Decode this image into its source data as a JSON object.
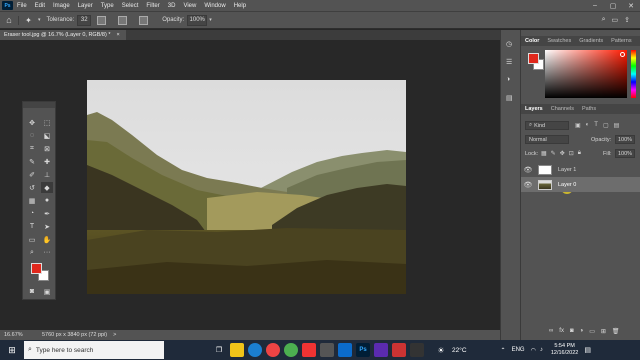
{
  "app": {
    "menu": [
      "File",
      "Edit",
      "Image",
      "Layer",
      "Type",
      "Select",
      "Filter",
      "3D",
      "View",
      "Window",
      "Help"
    ],
    "logo": "Ps"
  },
  "options": {
    "tolerance_label": "Tolerance:",
    "tolerance_value": "32",
    "opacity_label": "Opacity:",
    "opacity_value": "100%"
  },
  "document": {
    "tab_title": "Eraser tool.jpg @ 16.7% (Layer 0, RGB/8) *",
    "tab_close": "×"
  },
  "status": {
    "zoom": "16.67%",
    "doc_size": "5760 px x 3840 px (72 ppi)",
    "arrow": ">"
  },
  "panels": {
    "color_tabs": [
      "Color",
      "Swatches",
      "Gradients",
      "Patterns"
    ],
    "layers_tabs": [
      "Layers",
      "Channels",
      "Paths"
    ],
    "kind_label": "Kind",
    "blend_mode": "Normal",
    "opacity_label": "Opacity:",
    "opacity_value": "100%",
    "lock_label": "Lock:",
    "fill_label": "Fill:",
    "fill_value": "100%",
    "layers": [
      {
        "name": "Layer 1"
      },
      {
        "name": "Layer 0"
      }
    ],
    "bottom_icons": [
      "link-icon",
      "fx-icon",
      "mask-icon",
      "adjustment-icon",
      "group-icon",
      "new-layer-icon",
      "trash-icon"
    ],
    "fx_label": "fx"
  },
  "taskbar": {
    "search_placeholder": "Type here to search",
    "temperature": "22°C",
    "language": "ENG",
    "time": "5:54 PM",
    "date": "12/16/2022"
  },
  "colors": {
    "foreground": "#e0281c",
    "background": "#ffffff",
    "accent": "#31a8ff"
  }
}
